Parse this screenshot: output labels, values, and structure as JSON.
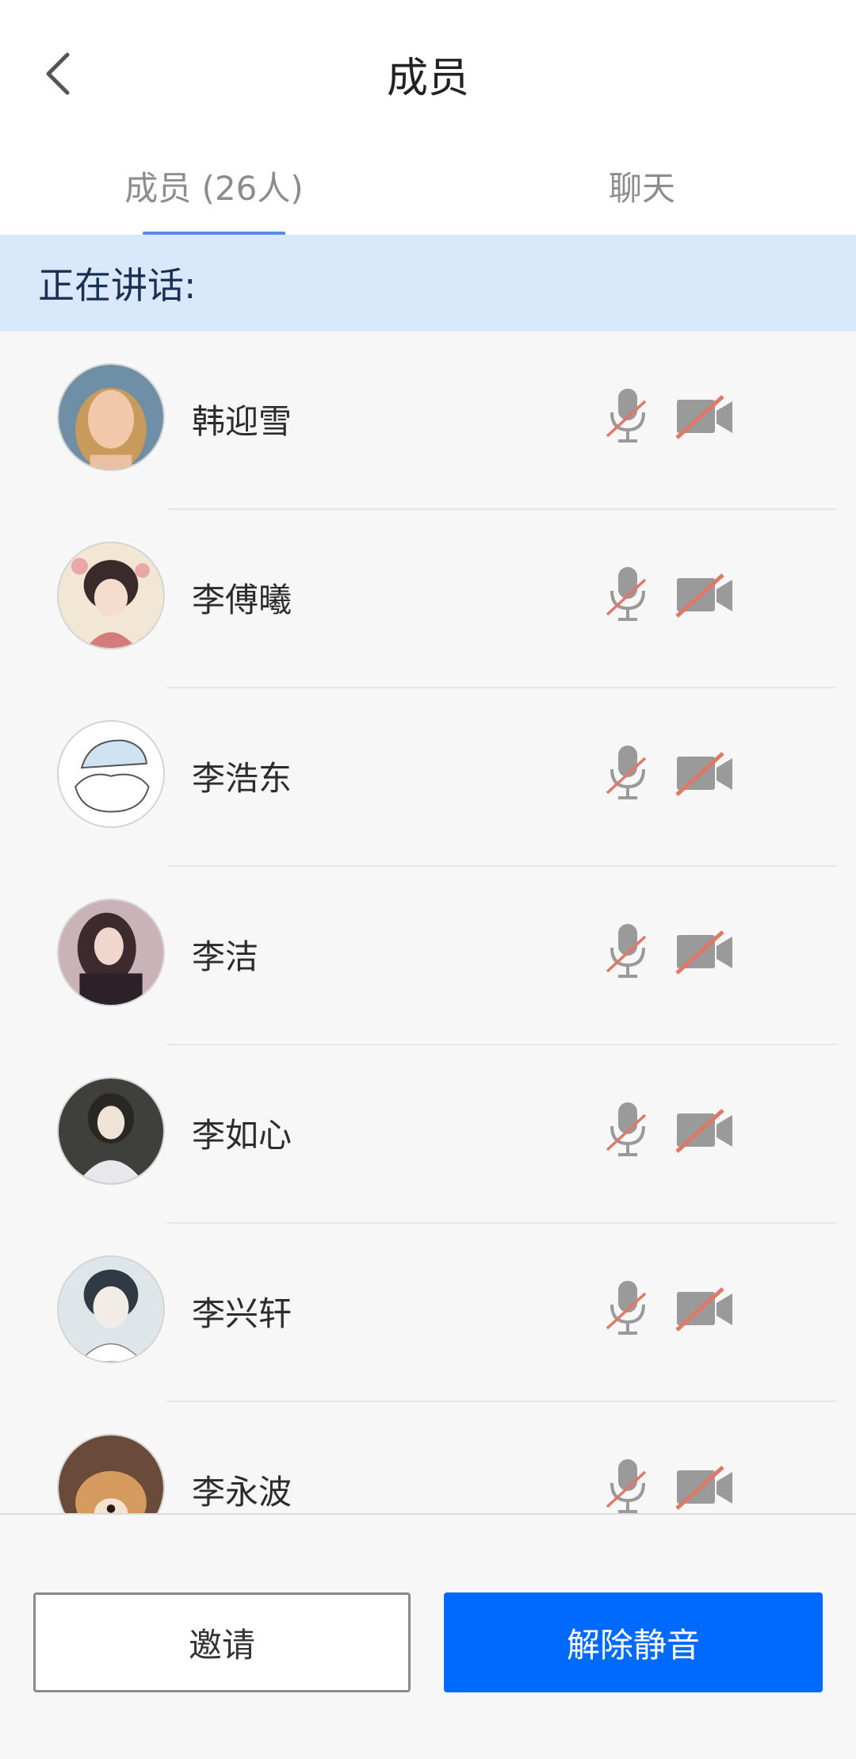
{
  "header": {
    "title": "成员"
  },
  "tabs": [
    {
      "label": "成员 (26人)",
      "active": true
    },
    {
      "label": "聊天",
      "active": false
    }
  ],
  "speaking": {
    "label": "正在讲话:"
  },
  "members": [
    {
      "name": "韩迎雪",
      "mic_muted": true,
      "camera_off": true
    },
    {
      "name": "李傅曦",
      "mic_muted": true,
      "camera_off": true
    },
    {
      "name": "李浩东",
      "mic_muted": true,
      "camera_off": true
    },
    {
      "name": "李洁",
      "mic_muted": true,
      "camera_off": true
    },
    {
      "name": "李如心",
      "mic_muted": true,
      "camera_off": true
    },
    {
      "name": "李兴轩",
      "mic_muted": true,
      "camera_off": true
    },
    {
      "name": "李永波",
      "mic_muted": true,
      "camera_off": true
    }
  ],
  "buttons": {
    "invite": "邀请",
    "unmute": "解除静音"
  },
  "colors": {
    "accent": "#006aff",
    "banner": "#d9e8fb",
    "muted_slash": "#e07868",
    "icon_gray": "#9a9a9a"
  }
}
